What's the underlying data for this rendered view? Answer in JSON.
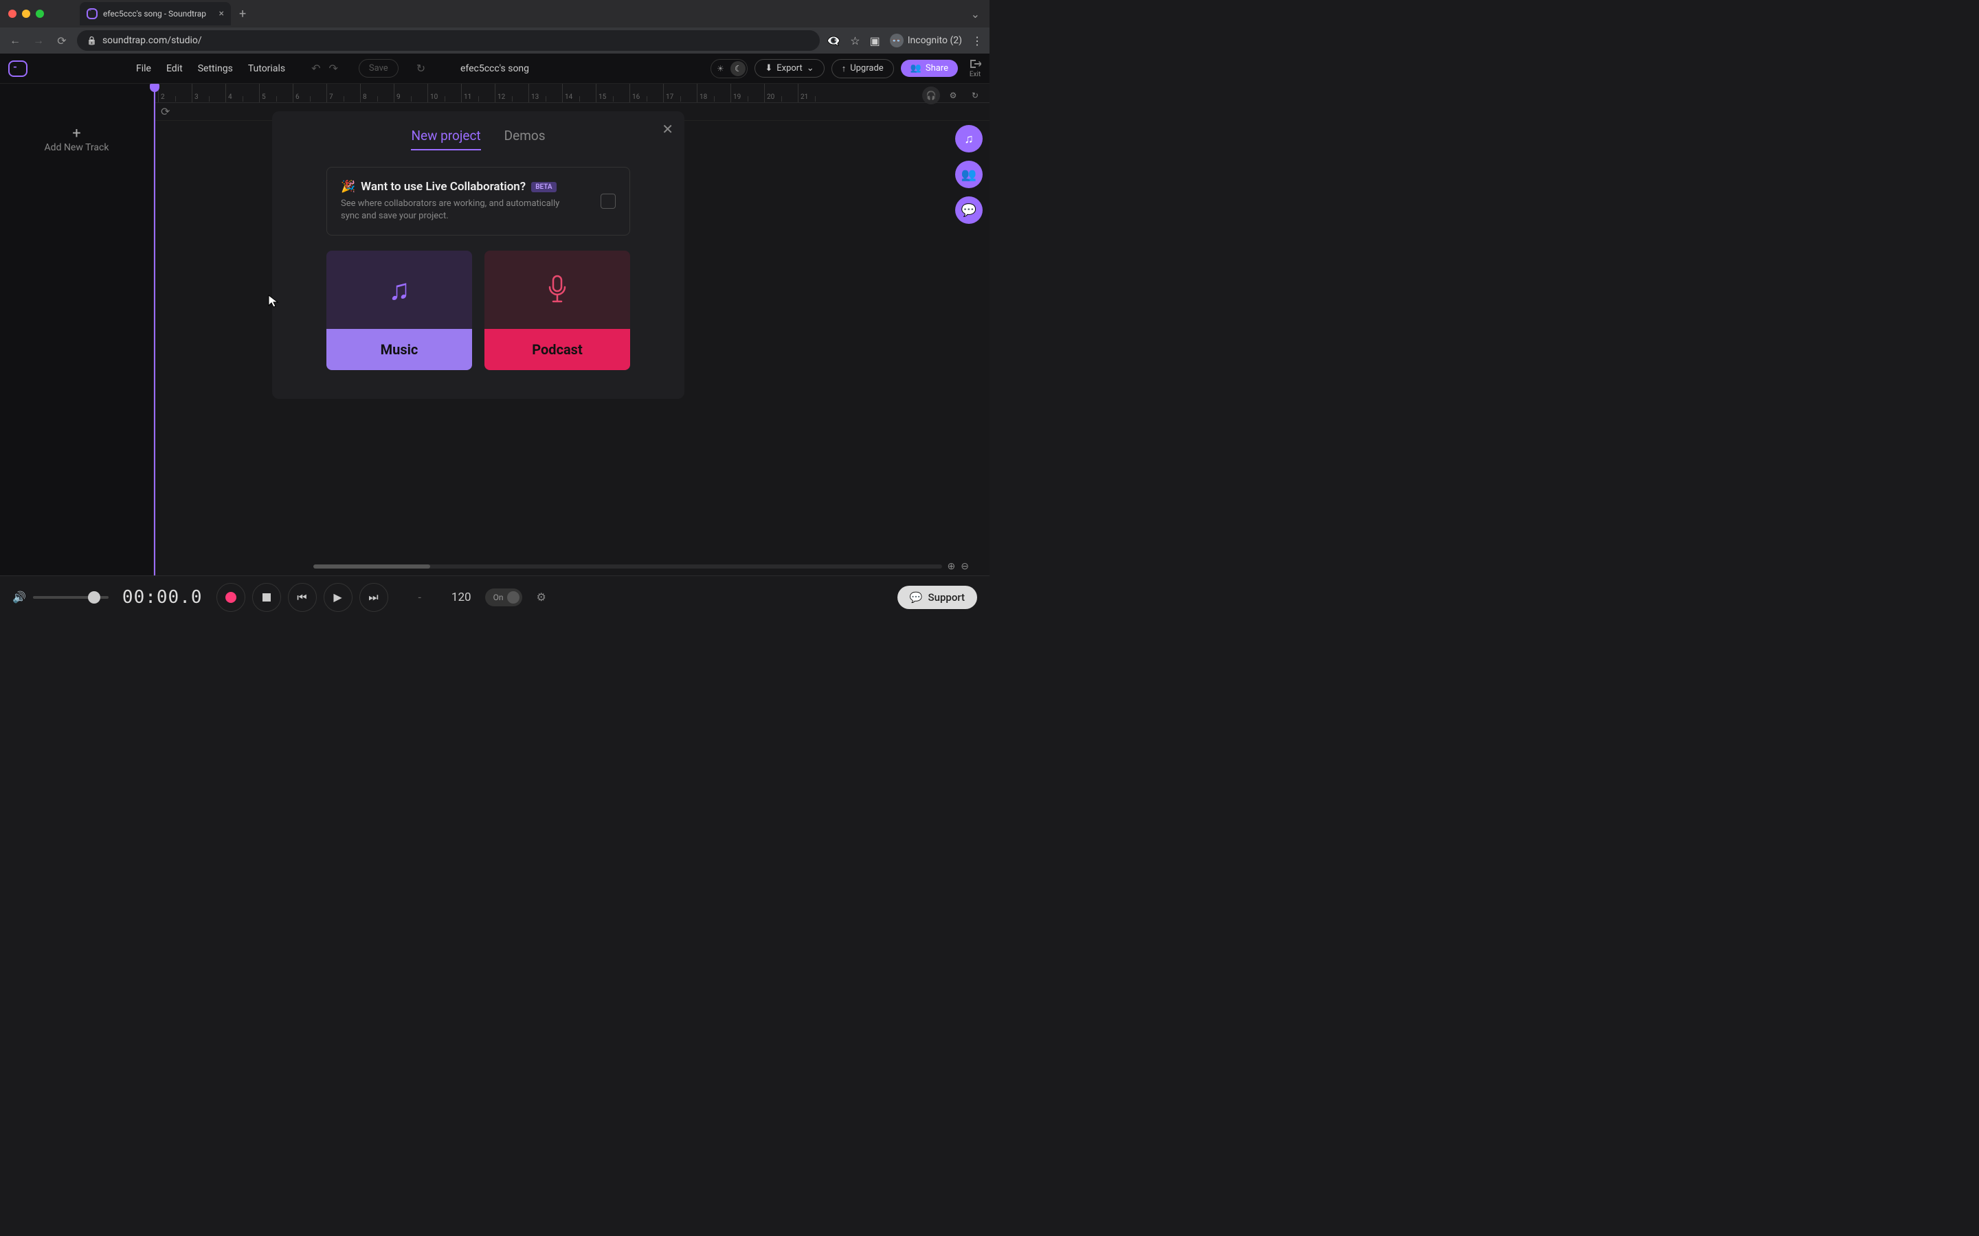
{
  "browser": {
    "tab_title": "efec5ccc's song - Soundtrap",
    "url": "soundtrap.com/studio/",
    "incognito_label": "Incognito (2)"
  },
  "topbar": {
    "menu": {
      "file": "File",
      "edit": "Edit",
      "settings": "Settings",
      "tutorials": "Tutorials"
    },
    "save": "Save",
    "project_title": "efec5ccc's song",
    "export": "Export",
    "upgrade": "Upgrade",
    "share": "Share",
    "exit": "Exit"
  },
  "track_panel": {
    "add_track": "Add New Track"
  },
  "ruler_marks": [
    "2",
    "3",
    "4",
    "5",
    "6",
    "7",
    "8",
    "9",
    "10",
    "11",
    "12",
    "13",
    "14",
    "15",
    "16",
    "17",
    "18",
    "19",
    "20",
    "21"
  ],
  "modal": {
    "tabs": {
      "new_project": "New project",
      "demos": "Demos"
    },
    "collab_title": "Want to use Live Collaboration?",
    "collab_beta": "BETA",
    "collab_desc": "See where collaborators are working, and automatically sync and save your project.",
    "card_music": "Music",
    "card_podcast": "Podcast"
  },
  "transport": {
    "timecode": "00:00.0",
    "dash": "-",
    "bpm": "120",
    "toggle_label": "On"
  },
  "support": {
    "label": "Support"
  }
}
